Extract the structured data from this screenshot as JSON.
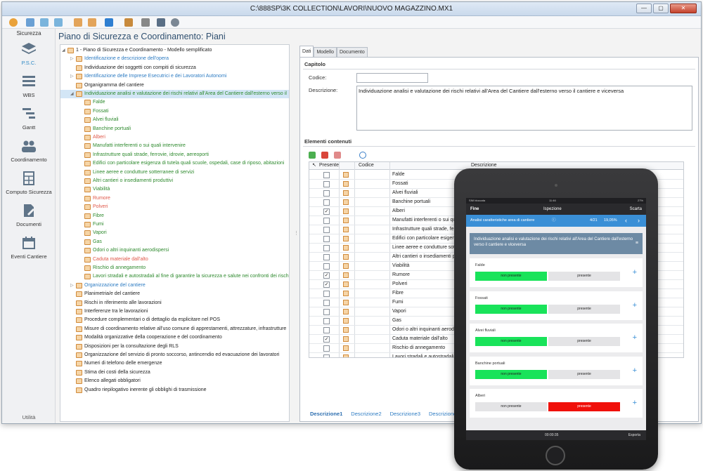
{
  "window": {
    "title": "C:\\888SP\\3K COLLECTION\\LAVORI\\NUOVO MAGAZZINO.MX1",
    "min": "—",
    "max": "▢",
    "close": "✕"
  },
  "nav": {
    "tab_label": "Sicurezza",
    "items": [
      "P.S.C.",
      "WBS",
      "Gantt",
      "Coordinamento",
      "Computo Sicurezza",
      "Documenti",
      "Eventi Cantiere"
    ],
    "footer": "Utilità"
  },
  "page_title": "Piano di Sicurezza e Coordinamento: Piani",
  "tree": {
    "rows": [
      {
        "text": "1 - Piano di Sicurezza e Coordinamento  -  Modello semplificato",
        "lvl": 0,
        "color": "c-dark",
        "arrow": "◢"
      },
      {
        "text": "Identificazione e descrizione dell'opera",
        "lvl": 1,
        "color": "c-blue",
        "arrow": "▷"
      },
      {
        "text": "Individuazione dei soggetti con compiti di sicurezza",
        "lvl": 1,
        "color": "c-dark",
        "arrow": ""
      },
      {
        "text": "Identificazione delle Imprese Esecutrici e dei Lavoratori Autonomi",
        "lvl": 1,
        "color": "c-blue",
        "arrow": "▷"
      },
      {
        "text": "Organigramma del cantiere",
        "lvl": 1,
        "color": "c-dark",
        "arrow": ""
      },
      {
        "text": "Individuazione analisi e valutazione dei rischi relativi all'Area del Cantiere dall'esterno verso il",
        "lvl": 1,
        "color": "c-green",
        "arrow": "◢"
      },
      {
        "text": "Falde",
        "lvl": 2,
        "color": "c-green",
        "arrow": ""
      },
      {
        "text": "Fossati",
        "lvl": 2,
        "color": "c-green",
        "arrow": ""
      },
      {
        "text": "Alvei fluviali",
        "lvl": 2,
        "color": "c-green",
        "arrow": ""
      },
      {
        "text": "Banchine portuali",
        "lvl": 2,
        "color": "c-green",
        "arrow": ""
      },
      {
        "text": "Alberi",
        "lvl": 2,
        "color": "c-red",
        "arrow": ""
      },
      {
        "text": "Manufatti interferenti o sui quali intervenire",
        "lvl": 2,
        "color": "c-green",
        "arrow": ""
      },
      {
        "text": "Infrastrutture quali strade, ferrovie, idrovie, aereoporti",
        "lvl": 2,
        "color": "c-green",
        "arrow": ""
      },
      {
        "text": "Edifici con particolare esigenza di tutela quali scuole, ospedali, case di riposo, abitazioni",
        "lvl": 2,
        "color": "c-green",
        "arrow": ""
      },
      {
        "text": "Linee aeree e condutture sotterranee di servizi",
        "lvl": 2,
        "color": "c-green",
        "arrow": ""
      },
      {
        "text": "Altri cantieri o insediamenti produttivi",
        "lvl": 2,
        "color": "c-green",
        "arrow": ""
      },
      {
        "text": "Viabilità",
        "lvl": 2,
        "color": "c-green",
        "arrow": ""
      },
      {
        "text": "Rumore",
        "lvl": 2,
        "color": "c-red",
        "arrow": ""
      },
      {
        "text": "Polveri",
        "lvl": 2,
        "color": "c-red",
        "arrow": ""
      },
      {
        "text": "Fibre",
        "lvl": 2,
        "color": "c-green",
        "arrow": ""
      },
      {
        "text": "Fumi",
        "lvl": 2,
        "color": "c-green",
        "arrow": ""
      },
      {
        "text": "Vapori",
        "lvl": 2,
        "color": "c-green",
        "arrow": ""
      },
      {
        "text": "Gas",
        "lvl": 2,
        "color": "c-green",
        "arrow": ""
      },
      {
        "text": "Odori o altri inquinanti aerodispersi",
        "lvl": 2,
        "color": "c-green",
        "arrow": ""
      },
      {
        "text": "Caduta materiale dall'alto",
        "lvl": 2,
        "color": "c-red",
        "arrow": ""
      },
      {
        "text": "Rischio di annegamento",
        "lvl": 2,
        "color": "c-green",
        "arrow": ""
      },
      {
        "text": "Lavori stradali e autostradali al fine di garantire la sicurezza e salute nei confronti dei rischi",
        "lvl": 2,
        "color": "c-green",
        "arrow": ""
      },
      {
        "text": "Organizzazione del cantiere",
        "lvl": 1,
        "color": "c-blue",
        "arrow": "▷"
      },
      {
        "text": "Planimetria/e del cantiere",
        "lvl": 1,
        "color": "c-dark",
        "arrow": ""
      },
      {
        "text": "Rischi in riferimento alle lavorazioni",
        "lvl": 1,
        "color": "c-dark",
        "arrow": ""
      },
      {
        "text": "Interferenze tra le lavorazioni",
        "lvl": 1,
        "color": "c-dark",
        "arrow": ""
      },
      {
        "text": "Procedure complementari o di dettaglio da esplicitare nel POS",
        "lvl": 1,
        "color": "c-dark",
        "arrow": ""
      },
      {
        "text": "Misure di coordinamento relative all'uso comune di apprestamenti, attrezzature, infrastrutture",
        "lvl": 1,
        "color": "c-dark",
        "arrow": ""
      },
      {
        "text": "Modalità organizzative della cooperazione e del coordinamento",
        "lvl": 1,
        "color": "c-dark",
        "arrow": ""
      },
      {
        "text": "Disposizioni per la consultazione degli RLS",
        "lvl": 1,
        "color": "c-dark",
        "arrow": ""
      },
      {
        "text": "Organizzazione del servizio di pronto soccorso, antincendio ed evacuazione dei lavoratori",
        "lvl": 1,
        "color": "c-dark",
        "arrow": ""
      },
      {
        "text": "Numeri di telefono delle emergenze",
        "lvl": 1,
        "color": "c-dark",
        "arrow": ""
      },
      {
        "text": "Stima dei costi della sicurezza",
        "lvl": 1,
        "color": "c-dark",
        "arrow": ""
      },
      {
        "text": "Elenco allegati obbligatori",
        "lvl": 1,
        "color": "c-dark",
        "arrow": ""
      },
      {
        "text": "Quadro riepilogativo inerente gli obblighi di trasmissione",
        "lvl": 1,
        "color": "c-dark",
        "arrow": ""
      }
    ],
    "selected_index": 5
  },
  "tabs": [
    "Dati",
    "Modello",
    "Documento"
  ],
  "capitolo": {
    "heading": "Capitolo",
    "codice_label": "Codice:",
    "codice_value": "",
    "descrizione_label": "Descrizione:",
    "descrizione_value": "Individuazione analisi e valutazione dei rischi relativi all'Area del Cantiere dall'esterno verso il cantiere e viceversa"
  },
  "elementi": {
    "heading": "Elementi contenuti",
    "columns": [
      "Presente",
      "Codice",
      "Descrizione"
    ],
    "rows": [
      {
        "d": "Falde",
        "p": false
      },
      {
        "d": "Fossati",
        "p": false
      },
      {
        "d": "Alvei fluviali",
        "p": false
      },
      {
        "d": "Banchine portuali",
        "p": false
      },
      {
        "d": "Alberi",
        "p": true
      },
      {
        "d": "Manufatti interferenti o sui qua",
        "p": false
      },
      {
        "d": "Infrastrutture quali strade, fer",
        "p": false
      },
      {
        "d": "Edifici con particolare esigenz",
        "p": false
      },
      {
        "d": "Linee aeree e condutture sot",
        "p": false
      },
      {
        "d": "Altri cantieri o insediamenti pr",
        "p": false
      },
      {
        "d": "Viabilità",
        "p": false
      },
      {
        "d": "Rumore",
        "p": true
      },
      {
        "d": "Polveri",
        "p": true
      },
      {
        "d": "Fibre",
        "p": false
      },
      {
        "d": "Fumi",
        "p": false
      },
      {
        "d": "Vapori",
        "p": false
      },
      {
        "d": "Gas",
        "p": false
      },
      {
        "d": "Odori o altri inquinanti aerodis",
        "p": false
      },
      {
        "d": "Caduta materiale dall'alto",
        "p": true
      },
      {
        "d": "Rischio di annegamento",
        "p": false
      },
      {
        "d": "Lavori stradali e autostradali a",
        "p": false
      }
    ],
    "check_mark": "✓"
  },
  "desc_tabs": [
    "Descrizione1",
    "Descrizione2",
    "Descrizione3",
    "Descrizione"
  ],
  "tablet": {
    "status_left": "SIM bloccata",
    "status_time": "11:46",
    "status_right": "27%",
    "nav_left": "Fine",
    "nav_title": "Ispezione",
    "nav_right": "Scarta",
    "bar_title": "Analisi caratteristiche area di cantiere",
    "bar_count": "4/21",
    "bar_percent": "19,05%",
    "prev": "‹",
    "next": "›",
    "heading": "Individuazione analisi e valutazione dei rischi relativi all'Area del Cantiere dall'esterno verso il cantiere e viceversa",
    "menu_icon": "≡",
    "plus": "+",
    "cards": [
      {
        "label": "Falde",
        "opt1": "non presente",
        "opt2": "presente",
        "state": "non"
      },
      {
        "label": "Fossati",
        "opt1": "non presente",
        "opt2": "presente",
        "state": "non"
      },
      {
        "label": "Alvei fluviali",
        "opt1": "non presente",
        "opt2": "presente",
        "state": "non"
      },
      {
        "label": "Banchine portuali",
        "opt1": "non presente",
        "opt2": "presente",
        "state": "non"
      },
      {
        "label": "Alberi",
        "opt1": "non presente",
        "opt2": "presente",
        "state": "presente"
      }
    ],
    "foot_time": "00:00:35",
    "foot_right": "Esporta"
  },
  "colors": {
    "green": "#19e35a",
    "red": "#f0100a",
    "grey": "#e4e4e6",
    "accent": "#3a8fd6"
  }
}
